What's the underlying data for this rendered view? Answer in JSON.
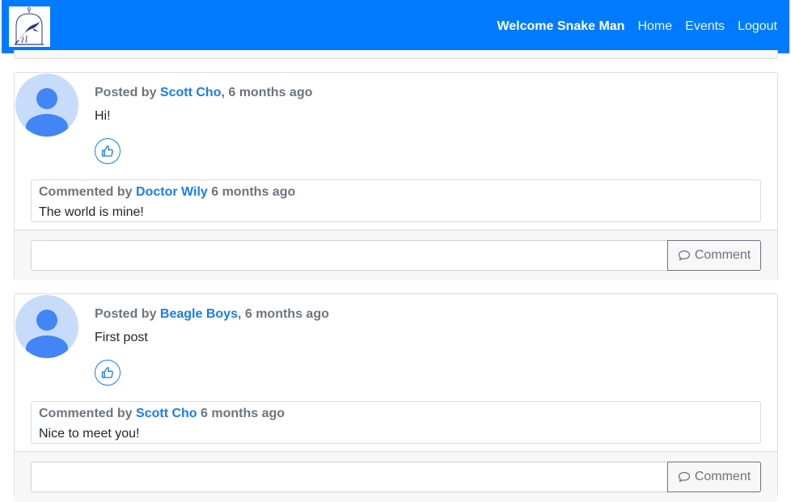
{
  "navbar": {
    "welcome_text": "Welcome Snake Man",
    "links": [
      "Home",
      "Events",
      "Logout"
    ],
    "background_color": "#007bff",
    "logo_icon": "bird-in-cage-logo"
  },
  "posts": [
    {
      "posted_by_label": "Posted by",
      "author": "Scott Cho",
      "time_ago": ", 6 months ago",
      "text": "Hi!",
      "like_icon": "thumbs-up-icon",
      "comments": [
        {
          "label": "Commented by",
          "author": "Doctor Wily",
          "time_ago": "6 months ago",
          "text": "The world is mine!"
        }
      ],
      "comment_input_value": "",
      "comment_button_label": "Comment"
    },
    {
      "posted_by_label": "Posted by",
      "author": "Beagle Boys",
      "time_ago": ", 6 months ago",
      "text": "First post",
      "like_icon": "thumbs-up-icon",
      "comments": [
        {
          "label": "Commented by",
          "author": "Scott Cho",
          "time_ago": "6 months ago",
          "text": "Nice to meet you!"
        }
      ],
      "comment_input_value": "",
      "comment_button_label": "Comment"
    }
  ],
  "colors": {
    "link": "#1a7cf0",
    "muted": "#6c757d",
    "avatar_bg": "#c7dcfb",
    "avatar_fg": "#4285f4"
  }
}
